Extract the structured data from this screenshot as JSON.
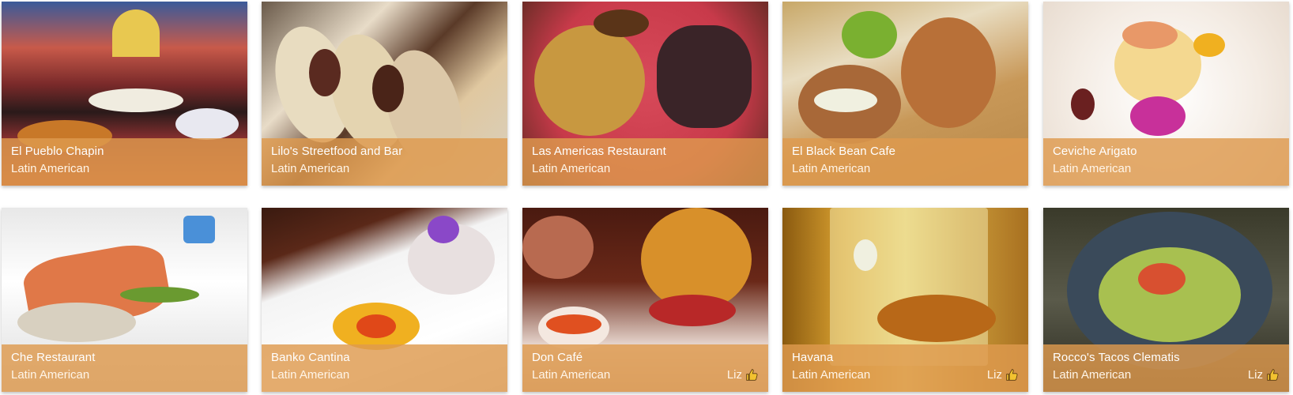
{
  "cards": [
    {
      "name": "El Pueblo Chapin",
      "cuisine": "Latin American",
      "badge": ""
    },
    {
      "name": "Lilo's Streetfood and Bar",
      "cuisine": "Latin American",
      "badge": ""
    },
    {
      "name": "Las Americas Restaurant",
      "cuisine": "Latin American",
      "badge": ""
    },
    {
      "name": "El Black Bean Cafe",
      "cuisine": "Latin American",
      "badge": ""
    },
    {
      "name": "Ceviche Arigato",
      "cuisine": "Latin American",
      "badge": ""
    },
    {
      "name": "Che Restaurant",
      "cuisine": "Latin American",
      "badge": ""
    },
    {
      "name": "Banko Cantina",
      "cuisine": "Latin American",
      "badge": ""
    },
    {
      "name": "Don Café",
      "cuisine": "Latin American",
      "badge": "Liz"
    },
    {
      "name": "Havana",
      "cuisine": "Latin American",
      "badge": "Liz"
    },
    {
      "name": "Rocco's Tacos Clematis",
      "cuisine": "Latin American",
      "badge": "Liz"
    }
  ],
  "colors": {
    "overlay": "#de9a4e",
    "text": "#ffffff",
    "thumb": "#f2c230"
  },
  "icons": {
    "thumb": "thumbs-up-icon"
  }
}
